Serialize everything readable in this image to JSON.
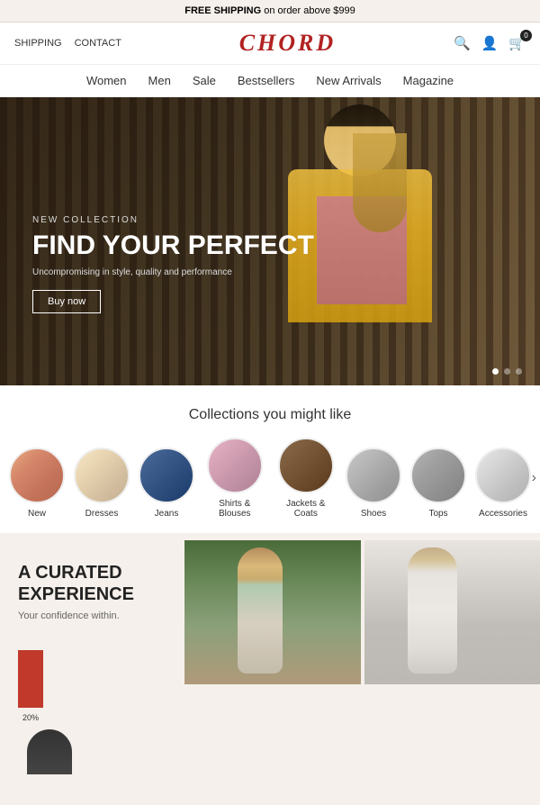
{
  "banner": {
    "text_pre": "FREE SHIPPING",
    "text_bold": "FREE SHIPPING",
    "text_post": " on order above $999"
  },
  "header": {
    "nav_left": [
      "SHIPPING",
      "CONTACT"
    ],
    "logo": "CHORD",
    "cart_count": "0"
  },
  "nav": {
    "items": [
      "Women",
      "Men",
      "Sale",
      "Bestsellers",
      "New Arrivals",
      "Magazine"
    ]
  },
  "hero": {
    "subtitle": "NEW COLLECTION",
    "title": "FIND YOUR PERFECT",
    "description": "Uncompromising in style, quality and performance",
    "cta_label": "Buy now"
  },
  "collections": {
    "section_title": "Collections you might like",
    "items": [
      {
        "label": "New",
        "color_class": "c-new"
      },
      {
        "label": "Dresses",
        "color_class": "c-dresses"
      },
      {
        "label": "Jeans",
        "color_class": "c-jeans"
      },
      {
        "label": "Shirts & Blouses",
        "color_class": "c-shirts"
      },
      {
        "label": "Jackets & Coats",
        "color_class": "c-jackets"
      },
      {
        "label": "Shoes",
        "color_class": "c-shoes"
      },
      {
        "label": "Tops",
        "color_class": "c-tops"
      },
      {
        "label": "Accessories",
        "color_class": "c-accessories"
      }
    ]
  },
  "curated": {
    "title": "A CURATED EXPERIENCE",
    "description": "Your confidence within.",
    "bar_label": "20%"
  },
  "icons": {
    "search": "🔍",
    "user": "👤",
    "cart": "🛒",
    "arrow_right": "›"
  }
}
